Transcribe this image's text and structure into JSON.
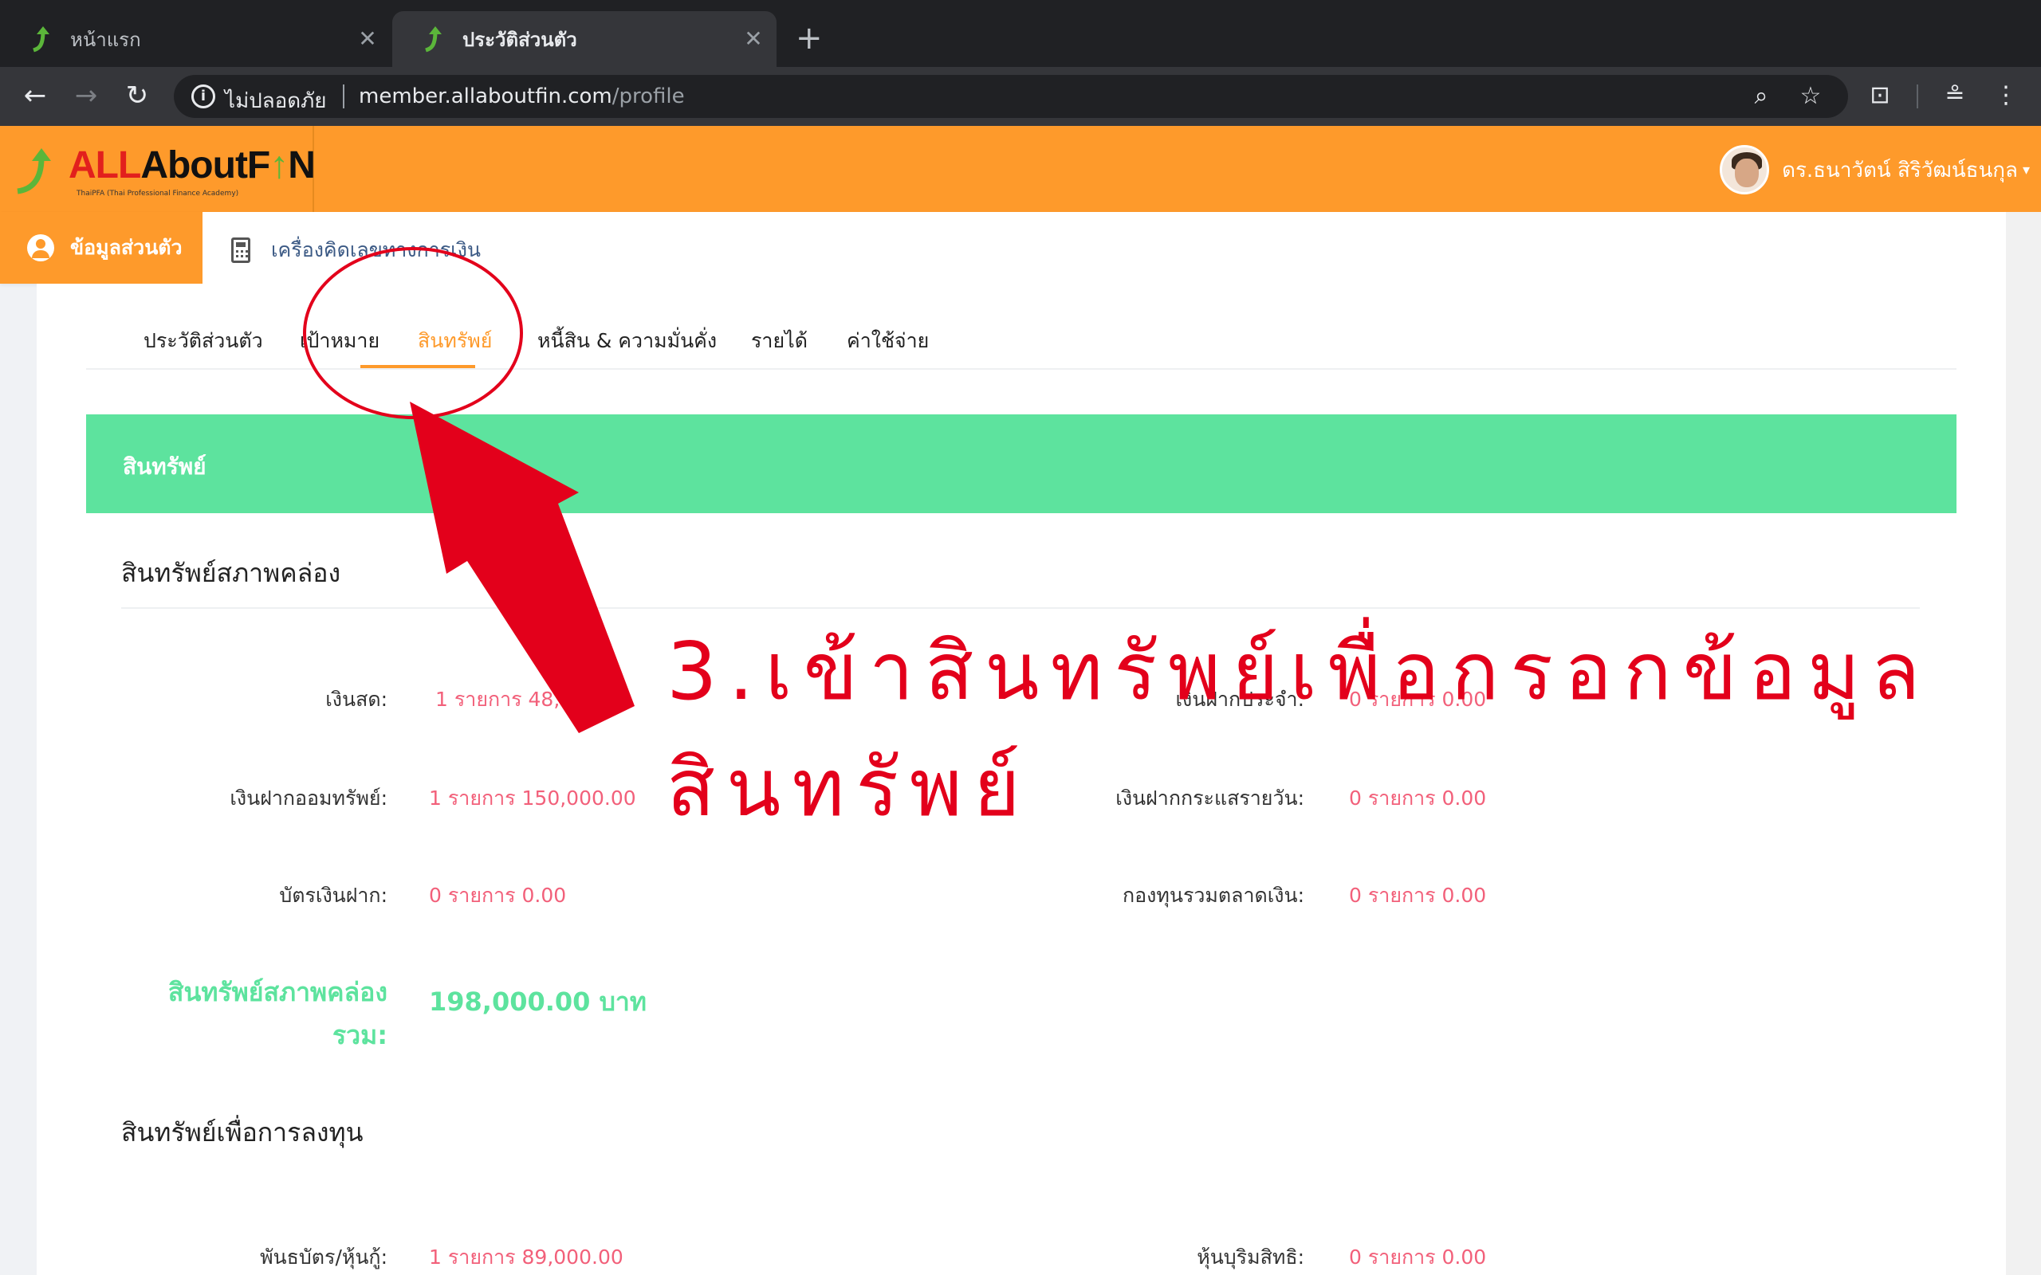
{
  "browser": {
    "tabs": [
      {
        "title": "หน้าแรก",
        "active": false
      },
      {
        "title": "ประวัติส่วนตัว",
        "active": true
      }
    ],
    "security_label": "ไม่ปลอดภัย",
    "url_host": "member.allaboutfin.com",
    "url_path": "/profile"
  },
  "header": {
    "logo_all": "ALL",
    "logo_about": "AboutF",
    "logo_fin_n": "N",
    "logo_sub": "ThaiPFA (Thai Professional Finance Academy)",
    "user_name": "ดร.ธนาวัตน์ สิริวัฒน์ธนกุล"
  },
  "subnav": {
    "profile_label": "ข้อมูลส่วนตัว",
    "calculator_label": "เครื่องคิดเลขทางการเงิน"
  },
  "page_tabs": [
    "ประวัติส่วนตัว",
    "เป้าหมาย",
    "สินทรัพย์",
    "หนี้สิน & ความมั่นคั่ง",
    "รายได้",
    "ค่าใช้จ่าย"
  ],
  "section": {
    "title": "สินทรัพย์",
    "liquid_heading": "สินทรัพย์สภาพคล่อง",
    "liquid_fields": [
      {
        "label": "เงินสด:",
        "value": "1 รายการ 48,0"
      },
      {
        "label": "เงินฝากประจำ:",
        "value": "0 รายการ 0.00"
      },
      {
        "label": "เงินฝากออมทรัพย์:",
        "value": "1 รายการ 150,000.00"
      },
      {
        "label": "เงินฝากกระแสรายวัน:",
        "value": "0 รายการ 0.00"
      },
      {
        "label": "บัตรเงินฝาก:",
        "value": "0 รายการ 0.00"
      },
      {
        "label": "กองทุนรวมตลาดเงิน:",
        "value": "0 รายการ 0.00"
      }
    ],
    "liquid_total_label": "สินทรัพย์สภาพคล่องรวม:",
    "liquid_total_value": "198,000.00 บาท",
    "invest_heading": "สินทรัพย์เพื่อการลงทุน",
    "invest_fields": [
      {
        "label": "พันธบัตร/หุ้นกู้:",
        "value": "1 รายการ 89,000.00"
      },
      {
        "label": "หุ้นบุริมสิทธิ:",
        "value": "0 รายการ 0.00"
      }
    ]
  },
  "annotation": {
    "text": "3.เข้าสินทรัพย์เพื่อกรอกข้อมูลสินทรัพย์",
    "color": "#e3001b"
  },
  "colors": {
    "brand_orange": "#fe9a2b",
    "section_green": "#5de39e",
    "value_red": "#f2607a"
  }
}
